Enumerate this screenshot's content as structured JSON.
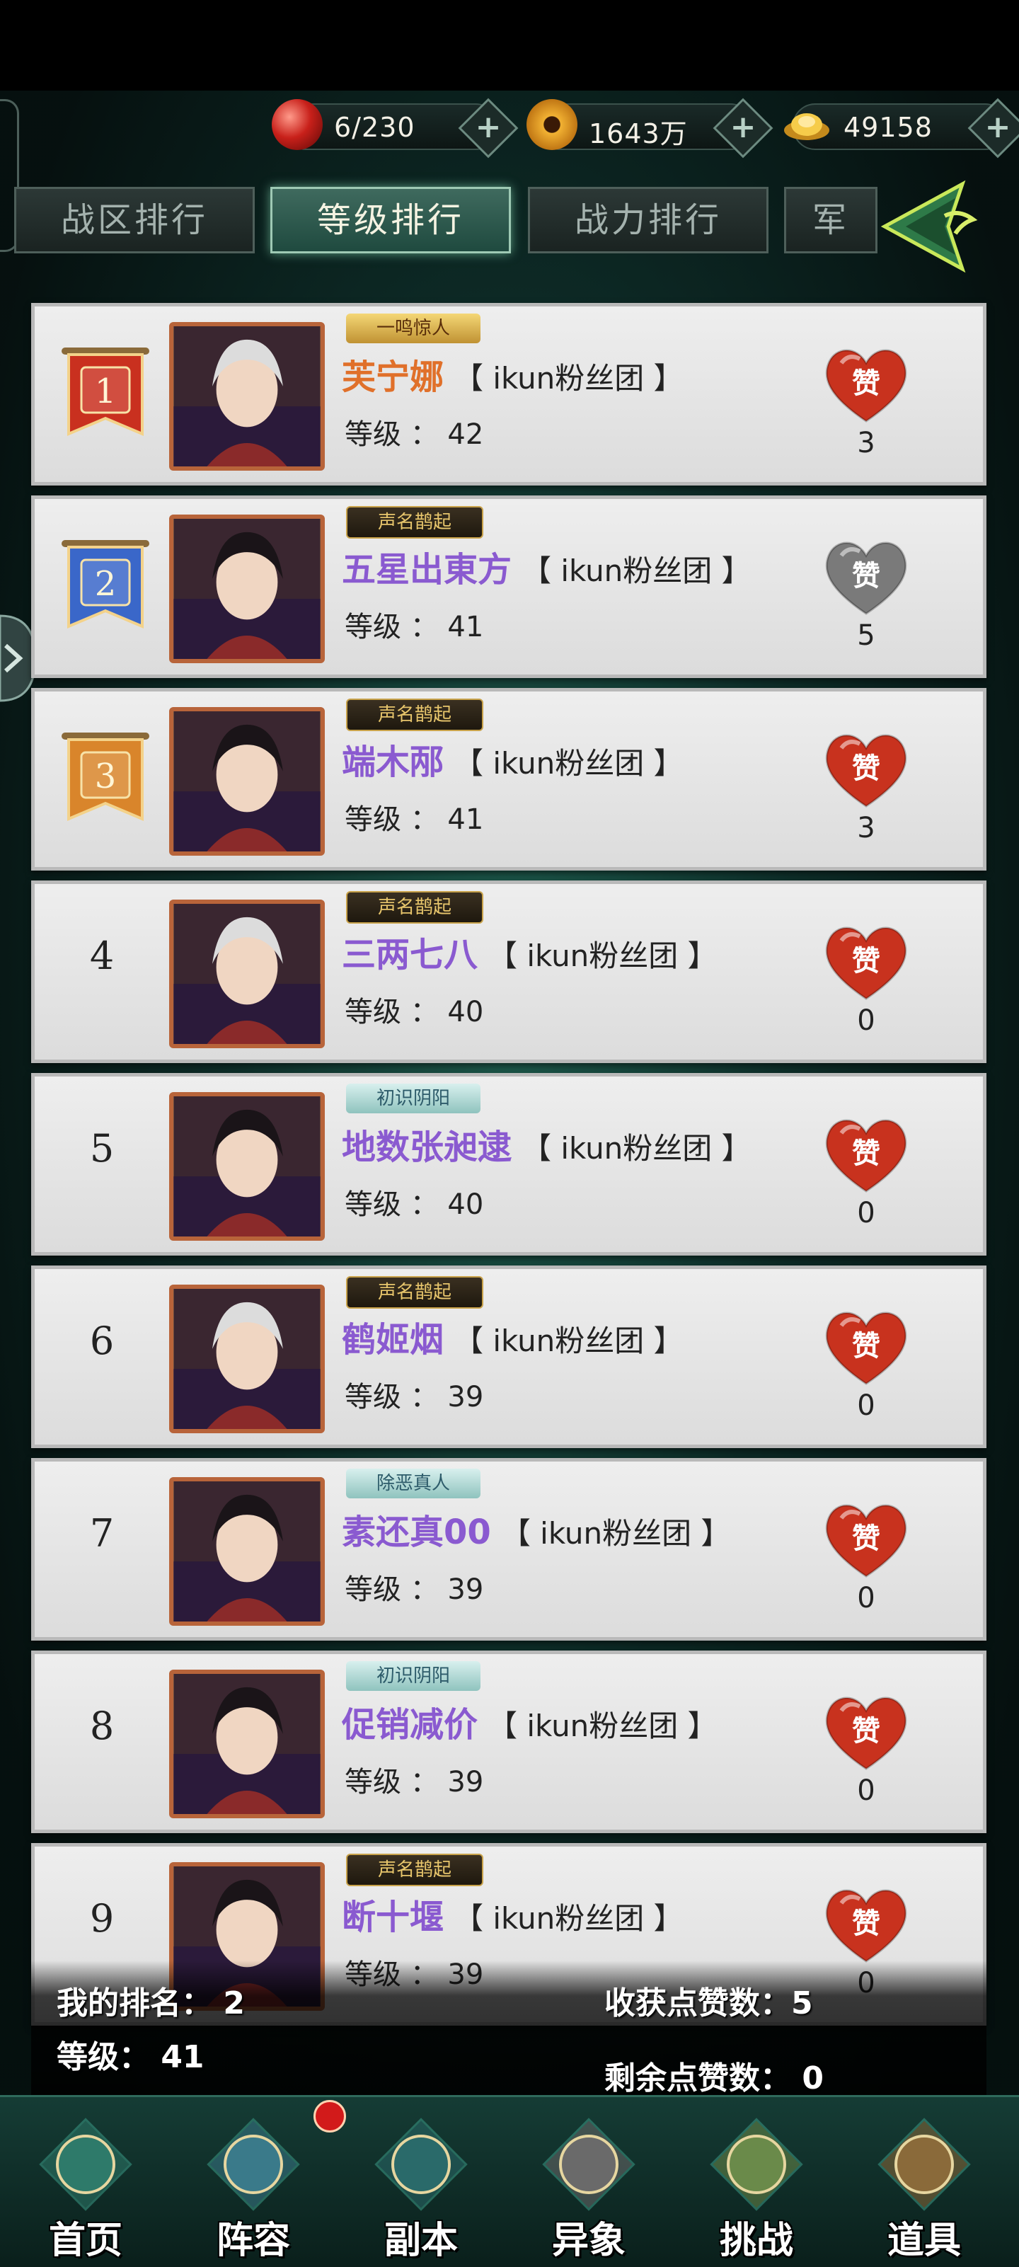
{
  "resources": [
    {
      "icon": "red-orb-icon",
      "value": "6/230"
    },
    {
      "icon": "gold-coin-icon",
      "value": "1643万"
    },
    {
      "icon": "gold-ingot-icon",
      "value": "49158"
    }
  ],
  "tabs": [
    {
      "label": "战区排行",
      "active": false
    },
    {
      "label": "等级排行",
      "active": true
    },
    {
      "label": "战力排行",
      "active": false
    },
    {
      "label": "军",
      "active": false
    }
  ],
  "rows": [
    {
      "rank": "1",
      "badge": "一鸣惊人",
      "badge_style": "gold",
      "name": "芙宁娜",
      "name_color": "#e0702a",
      "guild": "【 ikun粉丝团 】",
      "level": "等级 ： 42",
      "likes": "3",
      "like_state": "red"
    },
    {
      "rank": "2",
      "badge": "声名鹊起",
      "badge_style": "dark",
      "name": "五星出東方",
      "name_color": "#8a5ad0",
      "guild": "【 ikun粉丝团 】",
      "level": "等级 ： 41",
      "likes": "5",
      "like_state": "grey"
    },
    {
      "rank": "3",
      "badge": "声名鹊起",
      "badge_style": "dark",
      "name": "端木邴",
      "name_color": "#8a5ad0",
      "guild": "【 ikun粉丝团 】",
      "level": "等级 ： 41",
      "likes": "3",
      "like_state": "red"
    },
    {
      "rank": "4",
      "badge": "声名鹊起",
      "badge_style": "dark",
      "name": "三两七八",
      "name_color": "#8a5ad0",
      "guild": "【 ikun粉丝团 】",
      "level": "等级 ： 40",
      "likes": "0",
      "like_state": "red"
    },
    {
      "rank": "5",
      "badge": "初识阴阳",
      "badge_style": "teal",
      "name": "地数张昶逮",
      "name_color": "#8a5ad0",
      "guild": "【 ikun粉丝团 】",
      "level": "等级 ： 40",
      "likes": "0",
      "like_state": "red"
    },
    {
      "rank": "6",
      "badge": "声名鹊起",
      "badge_style": "dark",
      "name": "鹤姬烟",
      "name_color": "#8a5ad0",
      "guild": "【 ikun粉丝团 】",
      "level": "等级 ： 39",
      "likes": "0",
      "like_state": "red"
    },
    {
      "rank": "7",
      "badge": "除恶真人",
      "badge_style": "teal",
      "name": "素还真00",
      "name_color": "#8a5ad0",
      "guild": "【 ikun粉丝团 】",
      "level": "等级 ： 39",
      "likes": "0",
      "like_state": "red"
    },
    {
      "rank": "8",
      "badge": "初识阴阳",
      "badge_style": "teal",
      "name": "促销减价",
      "name_color": "#8a5ad0",
      "guild": "【 ikun粉丝团 】",
      "level": "等级 ： 39",
      "likes": "0",
      "like_state": "red"
    },
    {
      "rank": "9",
      "badge": "声名鹊起",
      "badge_style": "dark",
      "name": "断十堰",
      "name_color": "#8a5ad0",
      "guild": "【 ikun粉丝团 】",
      "level": "等级 ： 39",
      "likes": "0",
      "like_state": "red"
    }
  ],
  "like_label": "赞",
  "my_info": {
    "rank": "我的排名： 2",
    "level": "等级： 41",
    "received": "收获点赞数：5",
    "remaining": "剩余点赞数： 0"
  },
  "nav": [
    {
      "label": "首页",
      "icon": "pagoda-icon"
    },
    {
      "label": "阵容",
      "icon": "team-scroll-icon"
    },
    {
      "label": "副本",
      "icon": "sword-icon"
    },
    {
      "label": "异象",
      "icon": "crossed-swords-icon"
    },
    {
      "label": "挑战",
      "icon": "map-scroll-icon"
    },
    {
      "label": "道具",
      "icon": "item-bag-icon"
    }
  ],
  "colors": {
    "accent_teal": "#9ec9b4",
    "like_red": "#c8321e",
    "like_grey": "#7a7a7a",
    "rank1": "#c9301f",
    "rank2": "#3a67c9",
    "rank3": "#d9852b"
  }
}
